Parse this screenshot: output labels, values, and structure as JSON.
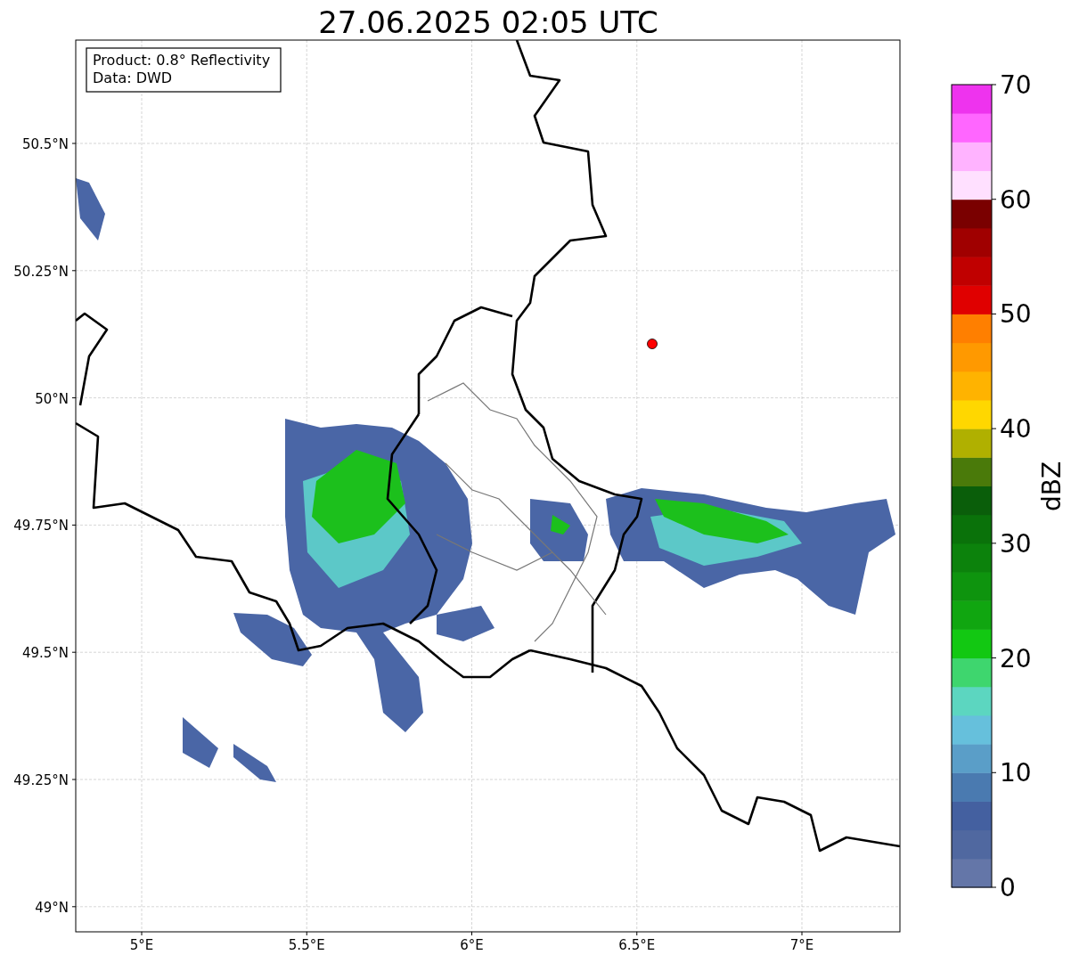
{
  "title": "27.06.2025 02:05 UTC",
  "info_box": [
    "Product: 0.8° Reflectivity",
    "Data: DWD"
  ],
  "y_ticks": [
    "50.5°N",
    "50.25°N",
    "50°N",
    "49.75°N",
    "49.5°N",
    "49.25°N",
    "49°N"
  ],
  "x_ticks": [
    "5°E",
    "5.5°E",
    "6°E",
    "6.5°E",
    "7°E"
  ],
  "colorbar": {
    "label": "dBZ",
    "ticks": [
      "70",
      "60",
      "50",
      "40",
      "30",
      "20",
      "10",
      "0"
    ],
    "bands": [
      {
        "color": "#6476a8"
      },
      {
        "color": "#5068a0"
      },
      {
        "color": "#4460a0"
      },
      {
        "color": "#4a7ab0"
      },
      {
        "color": "#5a9ec8"
      },
      {
        "color": "#66c0dc"
      },
      {
        "color": "#5cd6c0"
      },
      {
        "color": "#3ed66e"
      },
      {
        "color": "#12c812"
      },
      {
        "color": "#10a610"
      },
      {
        "color": "#0e940e"
      },
      {
        "color": "#0c820c"
      },
      {
        "color": "#0a720a"
      },
      {
        "color": "#0a5e0a"
      },
      {
        "color": "#4a7a0a"
      },
      {
        "color": "#b0b000"
      },
      {
        "color": "#ffd700"
      },
      {
        "color": "#ffb300"
      },
      {
        "color": "#ff9900"
      },
      {
        "color": "#ff7f00"
      },
      {
        "color": "#e00000"
      },
      {
        "color": "#c00000"
      },
      {
        "color": "#a00000"
      },
      {
        "color": "#7a0000"
      },
      {
        "color": "#ffe0ff"
      },
      {
        "color": "#ffb3ff"
      },
      {
        "color": "#ff66ff"
      },
      {
        "color": "#ee33ee"
      }
    ]
  }
}
